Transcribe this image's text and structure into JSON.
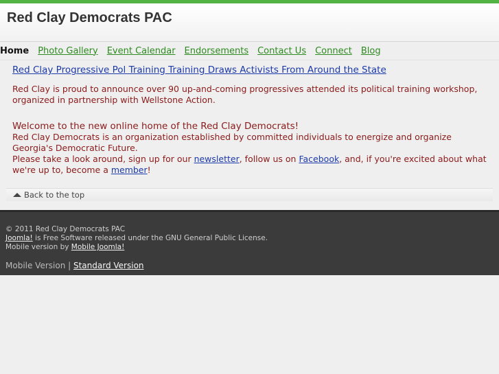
{
  "header": {
    "title": "Red Clay Democrats PAC"
  },
  "nav": {
    "items": [
      "Home",
      "Photo Gallery",
      "Event Calendar",
      "Endorsements",
      "Contact Us",
      "Connect",
      "Blog"
    ]
  },
  "article": {
    "headline": "Red Clay Progressive Pol Training Training Draws Activists From Around the State",
    "summary": "Red Clay is proud to announce over 90 up-and-coming progressives attended its political training workshop, organized in partnership with Wellstone Action."
  },
  "welcome": {
    "title": "Welcome to the new online home of the Red Clay Democrats!",
    "line1": "Red Clay Democrats is an organization established by committed individuals to energize and organize Georgia's Democratic Future.",
    "line2_a": "Please take a look around, sign up for our ",
    "newsletter": "newsletter",
    "line2_b": ", follow us on ",
    "facebook": "Facebook",
    "line2_c": ", and, if you're excited about what we're up to, become a ",
    "member": "member",
    "line2_d": "!"
  },
  "backtop": {
    "label": "Back to the top"
  },
  "footer": {
    "copyright": "© 2011 Red Clay Democrats PAC",
    "joomla": "Joomla!",
    "license": " is Free Software released under the GNU General Public License.",
    "mobile_by": "Mobile version by ",
    "mobile_joomla": "Mobile Joomla!",
    "mobile_version": "Mobile Version | ",
    "standard_version": "Standard Version"
  }
}
